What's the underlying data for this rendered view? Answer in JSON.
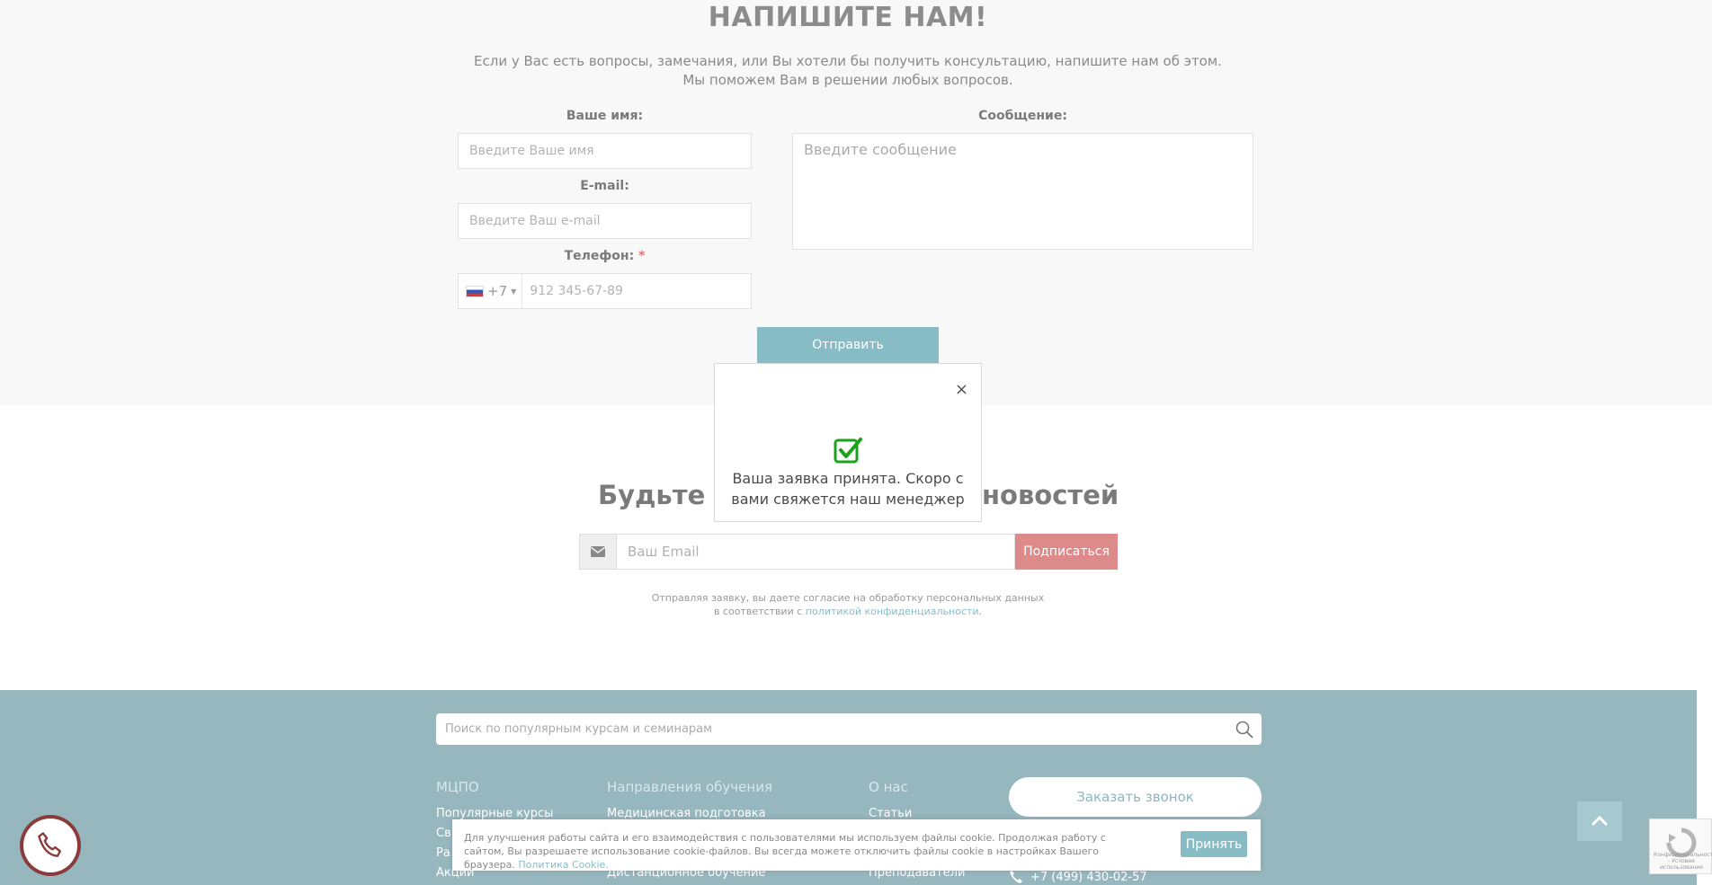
{
  "contact": {
    "title": "НАПИШИТЕ НАМ!",
    "intro_line1": "Если у Вас есть вопросы, замечания, или Вы хотели бы получить консультацию, напишите нам об этом.",
    "intro_line2": "Мы поможем Вам в решении любых вопросов.",
    "name_label": "Ваше имя:",
    "name_placeholder": "Введите Ваше имя",
    "email_label": "E-mail:",
    "email_placeholder": "Введите Ваш e-mail",
    "phone_label": "Телефон:",
    "phone_required": "*",
    "phone_code": "+7",
    "phone_placeholder": "912 345-67-89",
    "message_label": "Сообщение:",
    "message_placeholder": "Введите сообщение",
    "submit_label": "Отправить"
  },
  "popup": {
    "close": "×",
    "message": "Ваша заявка принята. Скоро с вами свяжется наш менеджер",
    "icon": "check-square-icon",
    "icon_color": "#1aa31a"
  },
  "subscribe": {
    "title_left": "Будьте в",
    "title_right": "новостей",
    "email_placeholder": "Ваш Email",
    "button_label": "Подписаться",
    "consent_line1": "Отправляя заявку, вы даете согласие на обработку персональных данных",
    "consent_line2_prefix": "в соответствии с",
    "consent_link": "политикой конфиденциальности",
    "consent_suffix": "."
  },
  "footer": {
    "search_placeholder": "Поиск по популярным курсам и семинарам",
    "col1_title": "МЦПО",
    "col1_items": [
      "Популярные курсы",
      "Св",
      "Ра",
      "Акции"
    ],
    "col2_title": "Направления обучения",
    "col2_items": [
      "Медицинская подготовка",
      "Дистанционное обучение"
    ],
    "col3_title": "О нас",
    "col3_items": [
      "Статьи",
      "Преподаватели"
    ],
    "callback_label": "Заказать звонок",
    "phone": "+7 (499) 430-02-57"
  },
  "cookie": {
    "text": "Для улучшения работы сайта и его взаимодействия с пользователями мы используем файлы cookie. Продолжая работу с сайтом, Вы разрешаете использование cookie-файлов. Вы всегда можете отключить файлы cookie в настройках Вашего браузера.",
    "policy_link": "Политика Cookie.",
    "accept_label": "Принять"
  },
  "colors": {
    "accent": "#88bcc4",
    "subscribe_button": "#dd8a8a",
    "footer_bg": "#97b7bf",
    "call_ring": "#8a3b3b"
  },
  "recaptcha": {
    "text": "Конфиденциальность - Условия использования"
  }
}
